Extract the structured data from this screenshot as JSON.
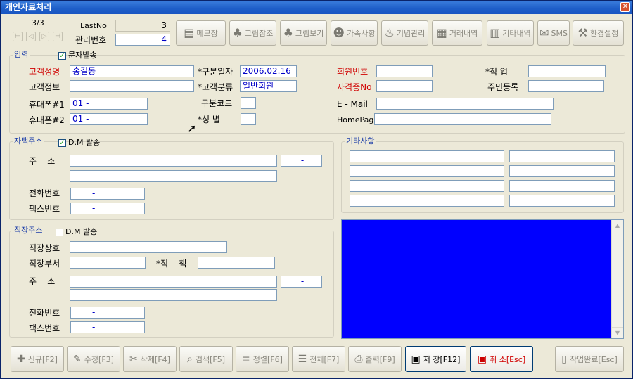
{
  "window": {
    "title": "개인자료처리",
    "close": "✕"
  },
  "nav": {
    "record": "3/3",
    "lastno_label": "LastNo",
    "lastno_value": "3",
    "mgmt_label": "관리번호",
    "mgmt_value": "4",
    "buttons": [
      "⊢",
      "◁",
      "▷",
      "⊣"
    ]
  },
  "toolbar": [
    {
      "label": "메모장",
      "icon": "memo-icon",
      "glyph": "▤"
    },
    {
      "label": "그림참조",
      "icon": "tree-icon",
      "glyph": "♣"
    },
    {
      "label": "그림보기",
      "icon": "tree-view-icon",
      "glyph": "♣"
    },
    {
      "label": "가족사항",
      "icon": "family-icon",
      "glyph": "☻"
    },
    {
      "label": "기념관리",
      "icon": "cake-icon",
      "glyph": "♨"
    },
    {
      "label": "거래내역",
      "icon": "transaction-icon",
      "glyph": "▦"
    },
    {
      "label": "기타내역",
      "icon": "etc-icon",
      "glyph": "▥"
    },
    {
      "label": "SMS",
      "icon": "sms-icon",
      "glyph": "✉"
    },
    {
      "label": "환경설정",
      "icon": "tools-icon",
      "glyph": "⚒"
    }
  ],
  "input_section": {
    "title": "입력",
    "sms_check": "문자발송",
    "sms_checked": true
  },
  "fields": {
    "name_label": "고객성명",
    "name_value": "홍길동",
    "info_label": "고객정보",
    "info_value": "",
    "phone1_label": "휴대폰#1",
    "phone1_value": "01  -",
    "phone2_label": "휴대폰#2",
    "phone2_value": "01  -",
    "date_label": "*구분일자",
    "date_value": "2006.02.16",
    "class_label": "*고객분류",
    "class_value": "일반회원",
    "code_label": "구분코드",
    "code_value": "",
    "gender_label": "*성   별",
    "gender_value": "",
    "member_label": "회원번호",
    "member_value": "",
    "cert_label": "자격증No",
    "cert_value": "",
    "email_label": "E - Mail",
    "email_value": "",
    "home_label": "HomePage",
    "home_value": "",
    "job_label": "*직    업",
    "job_value": "",
    "resident_label": "주민등록",
    "resident_value": "-"
  },
  "home_address": {
    "title": "자택주소",
    "dm_label": "D.M 발송",
    "dm_checked": true,
    "addr_label": "주    소",
    "zip_value": "-",
    "tel_label": "전화번호",
    "tel_value": "-",
    "fax_label": "팩스번호",
    "fax_value": "-"
  },
  "work_address": {
    "title": "직장주소",
    "dm_label": "D.M 발송",
    "dm_checked": false,
    "company_label": "직장상호",
    "dept_label": "직장부서",
    "position_label": "*직    책",
    "addr_label": "주    소",
    "zip_value": "-",
    "tel_label": "전화번호",
    "tel_value": "-",
    "fax_label": "팩스번호",
    "fax_value": "-"
  },
  "etc": {
    "title": "기타사항"
  },
  "bottom": [
    {
      "label": "신규[F2]",
      "icon": "new-icon",
      "glyph": "✚",
      "active": false
    },
    {
      "label": "수정[F3]",
      "icon": "edit-icon",
      "glyph": "✎",
      "active": false
    },
    {
      "label": "삭제[F4]",
      "icon": "delete-icon",
      "glyph": "✂",
      "active": false
    },
    {
      "label": "검색[F5]",
      "icon": "search-icon",
      "glyph": "⌕",
      "active": false
    },
    {
      "label": "정렬[F6]",
      "icon": "sort-icon",
      "glyph": "≡",
      "active": false
    },
    {
      "label": "전체[F7]",
      "icon": "list-icon",
      "glyph": "☰",
      "active": false
    },
    {
      "label": "출력[F9]",
      "icon": "print-icon",
      "glyph": "⎙",
      "active": false
    },
    {
      "label": "저 장[F12]",
      "icon": "save-icon",
      "glyph": "▣",
      "active": true
    },
    {
      "label": "취 소[Esc]",
      "icon": "cancel-icon",
      "glyph": "▣",
      "active": true
    },
    {
      "label": "작업완료[Esc]",
      "icon": "door-icon",
      "glyph": "▯",
      "active": false
    }
  ],
  "colors": {
    "notes_bg": "#0000ff",
    "accent_red": "#d00000",
    "accent_blue": "#0000c8"
  }
}
